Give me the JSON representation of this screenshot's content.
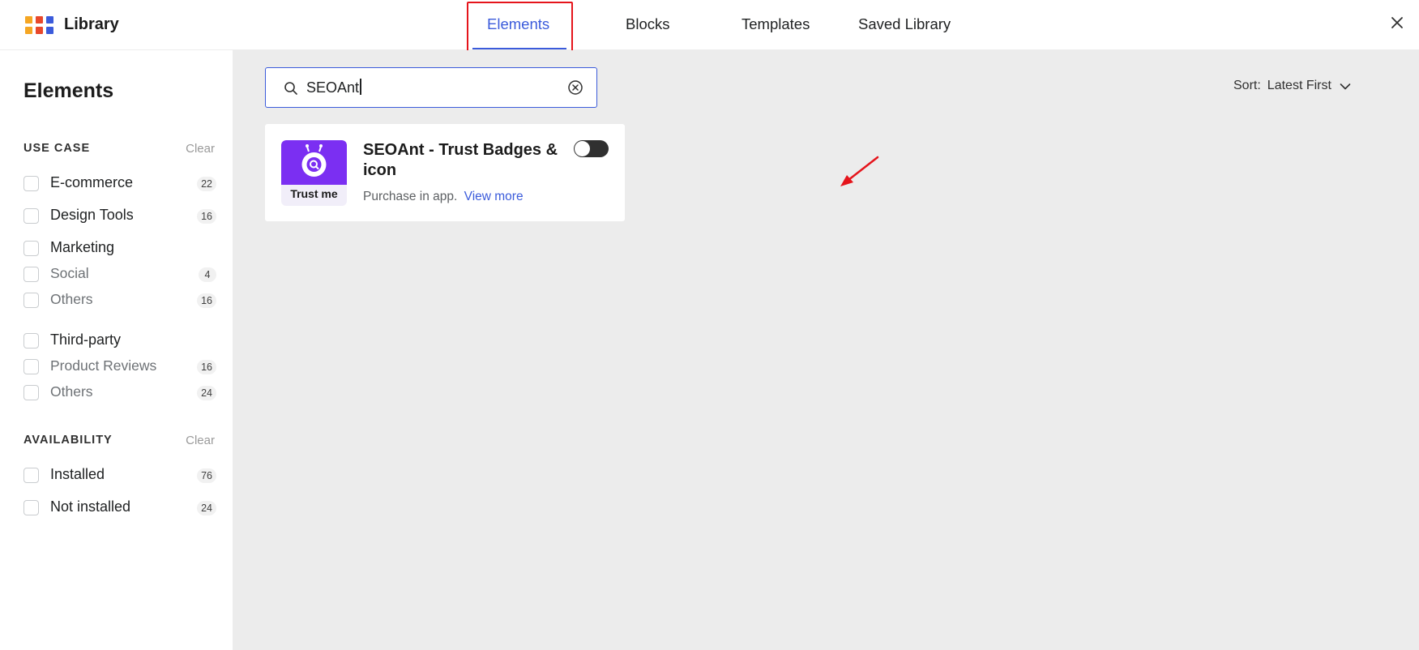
{
  "header": {
    "title": "Library",
    "logo_colors": [
      "#f5a623",
      "#e8482b",
      "#3b5bdb",
      "#f5a623",
      "#e8482b",
      "#3b5bdb"
    ],
    "tabs": [
      {
        "label": "Elements",
        "active": true
      },
      {
        "label": "Blocks",
        "active": false
      },
      {
        "label": "Templates",
        "active": false
      },
      {
        "label": "Saved Library",
        "active": false
      }
    ],
    "close_icon": "close-icon"
  },
  "sidebar": {
    "title": "Elements",
    "use_case": {
      "heading": "USE CASE",
      "clear": "Clear",
      "items": [
        {
          "label": "E-commerce",
          "count": "22",
          "sub": false
        },
        {
          "label": "Design Tools",
          "count": "16",
          "sub": false
        },
        {
          "label": "Marketing",
          "count": "",
          "sub": false
        },
        {
          "label": "Social",
          "count": "4",
          "sub": true
        },
        {
          "label": "Others",
          "count": "16",
          "sub": true
        },
        {
          "label": "Third-party",
          "count": "",
          "sub": false
        },
        {
          "label": "Product Reviews",
          "count": "16",
          "sub": true
        },
        {
          "label": "Others",
          "count": "24",
          "sub": true
        }
      ]
    },
    "availability": {
      "heading": "AVAILABILITY",
      "clear": "Clear",
      "items": [
        {
          "label": "Installed",
          "count": "76"
        },
        {
          "label": "Not installed",
          "count": "24"
        }
      ]
    }
  },
  "main": {
    "search": {
      "value": "SEOAnt",
      "icon": "search-icon",
      "clear_icon": "clear-circle-icon"
    },
    "sort": {
      "label": "Sort:",
      "value": "Latest First",
      "icon": "chevron-down-icon"
    },
    "results": [
      {
        "title": "SEOAnt - Trust Badges & icon",
        "thumb_text": "Trust me",
        "description": "Purchase in app.",
        "link": "View more",
        "toggle_on": false
      }
    ]
  },
  "colors": {
    "accent": "#3b5bdb",
    "highlight": "#e5141b",
    "thumb": "#7b2ff2"
  }
}
